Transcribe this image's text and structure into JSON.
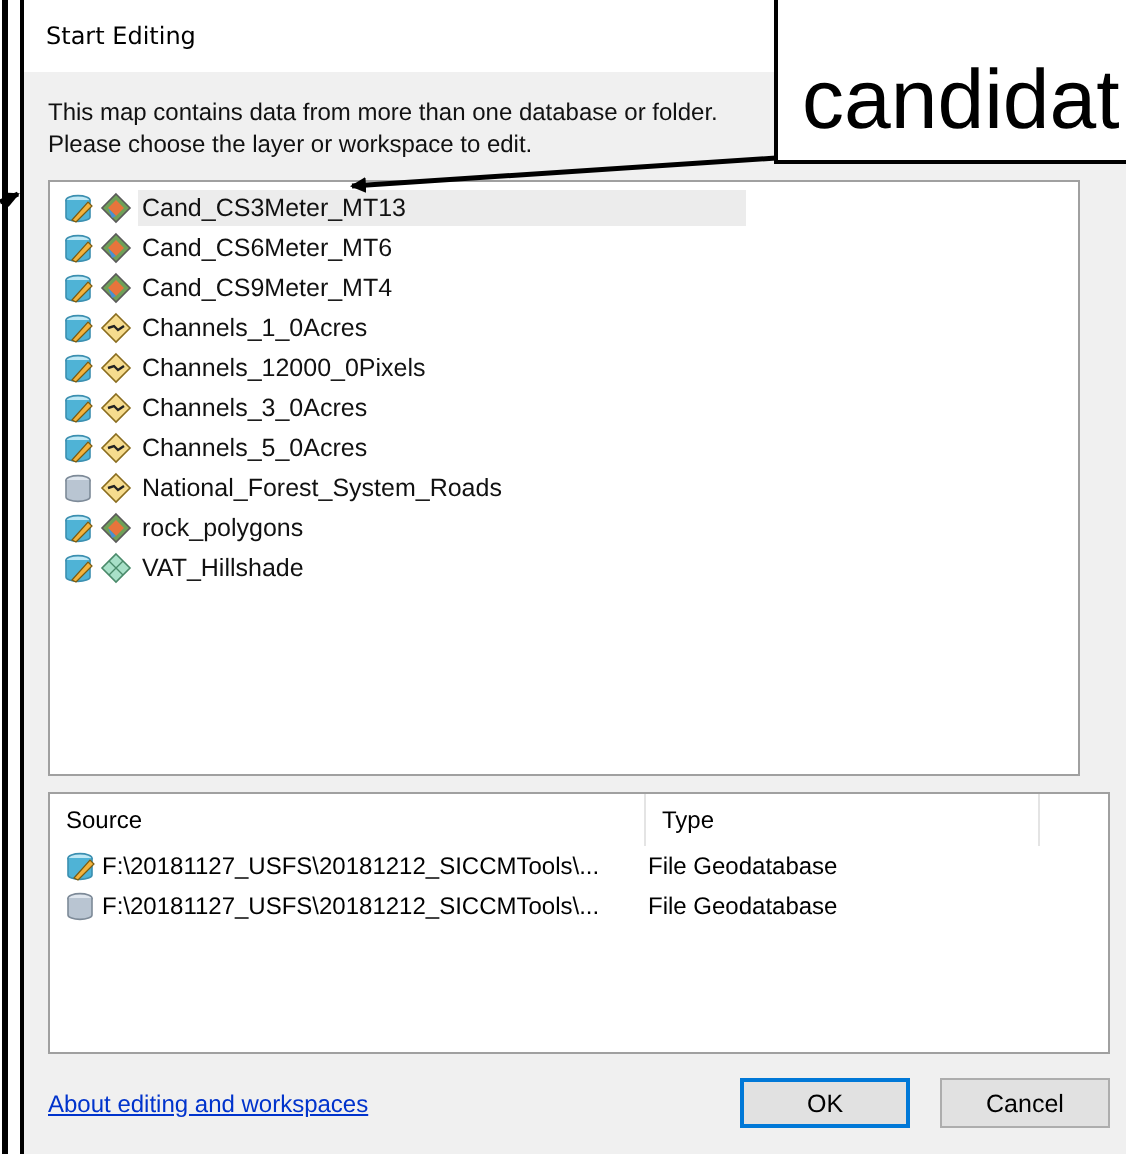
{
  "window": {
    "title": "Start Editing"
  },
  "message": [
    "This map contains data from more than one database or folder.",
    "Please choose the layer or workspace to edit."
  ],
  "layers": [
    {
      "name": "Cand_CS3Meter_MT13",
      "editable": true,
      "kind": "polygon",
      "selected": true
    },
    {
      "name": "Cand_CS6Meter_MT6",
      "editable": true,
      "kind": "polygon",
      "selected": false
    },
    {
      "name": "Cand_CS9Meter_MT4",
      "editable": true,
      "kind": "polygon",
      "selected": false
    },
    {
      "name": "Channels_1_0Acres",
      "editable": true,
      "kind": "line",
      "selected": false
    },
    {
      "name": "Channels_12000_0Pixels",
      "editable": true,
      "kind": "line",
      "selected": false
    },
    {
      "name": "Channels_3_0Acres",
      "editable": true,
      "kind": "line",
      "selected": false
    },
    {
      "name": "Channels_5_0Acres",
      "editable": true,
      "kind": "line",
      "selected": false
    },
    {
      "name": "National_Forest_System_Roads",
      "editable": false,
      "kind": "line",
      "selected": false
    },
    {
      "name": "rock_polygons",
      "editable": true,
      "kind": "polygon",
      "selected": false
    },
    {
      "name": "VAT_Hillshade",
      "editable": true,
      "kind": "grid",
      "selected": false
    }
  ],
  "sources": {
    "columns": [
      "Source",
      "Type"
    ],
    "rows": [
      {
        "editable": true,
        "source": "F:\\20181127_USFS\\20181212_SICCMTools\\...",
        "type": "File Geodatabase"
      },
      {
        "editable": false,
        "source": "F:\\20181127_USFS\\20181212_SICCMTools\\...",
        "type": "File Geodatabase"
      }
    ]
  },
  "help_link": "About editing and workspaces",
  "buttons": [
    {
      "label": "OK",
      "default": true
    },
    {
      "label": "Cancel",
      "default": false
    }
  ],
  "callout": {
    "text": "candidat"
  }
}
